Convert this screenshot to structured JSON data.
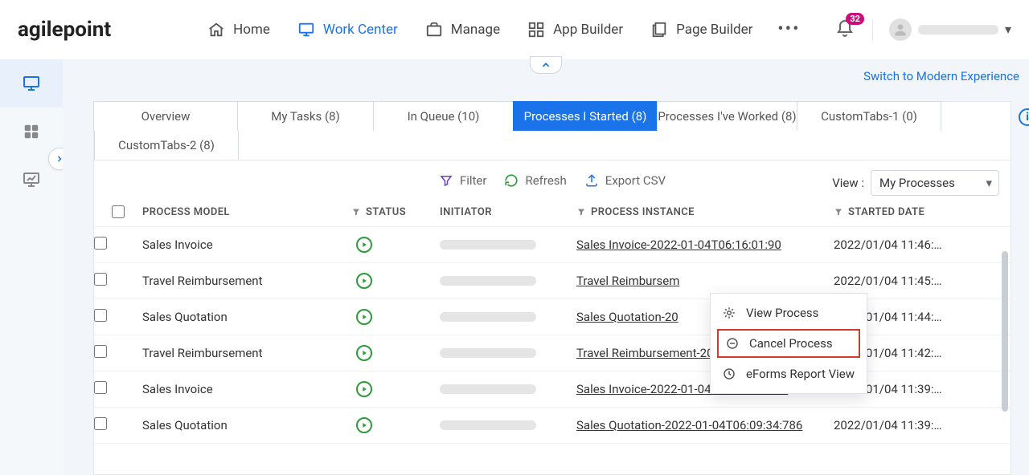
{
  "brand": "agilepoint",
  "nav": {
    "home": "Home",
    "workcenter": "Work Center",
    "manage": "Manage",
    "appbuilder": "App Builder",
    "pagebuilder": "Page Builder"
  },
  "notifications": {
    "count": "32"
  },
  "switch_link": "Switch to Modern Experience",
  "tabs": {
    "overview": "Overview",
    "mytasks": "My Tasks (8)",
    "inqueue": "In Queue (10)",
    "started": "Processes I Started (8)",
    "worked": "Processes I've Worked (8)",
    "custom1": "CustomTabs-1  (0)",
    "custom2": "CustomTabs-2  (8)",
    "widths": {
      "overview": 180,
      "mytasks": 170,
      "inqueue": 175,
      "started": 180,
      "worked": 175,
      "custom1": 180,
      "custom2": 180
    }
  },
  "toolbar": {
    "filter": "Filter",
    "refresh": "Refresh",
    "export": "Export CSV",
    "view_label": "View :",
    "view_selected": "My Processes"
  },
  "columns": {
    "model": "PROCESS MODEL",
    "status": "STATUS",
    "initiator": "INITIATOR",
    "instance": "PROCESS INSTANCE",
    "started": "STARTED DATE"
  },
  "rows": [
    {
      "model": "Sales Invoice",
      "instance": "Sales Invoice-2022-01-04T06:16:01:90",
      "date": "2022/01/04 11:46:…"
    },
    {
      "model": "Travel Reimbursement",
      "instance": "Travel Reimbursem",
      "date": "2022/01/04 11:45:…"
    },
    {
      "model": "Sales Quotation",
      "instance": "Sales Quotation-20",
      "date": "2022/01/04 11:44:…"
    },
    {
      "model": "Travel Reimbursement",
      "instance": "Travel Reimbursement-2022-01-04T06:12:31…",
      "date": "2022/01/04 11:42:…"
    },
    {
      "model": "Sales Invoice",
      "instance": "Sales Invoice-2022-01-04T06:09:46:223",
      "date": "2022/01/04 11:39:…"
    },
    {
      "model": "Sales Quotation",
      "instance": "Sales Quotation-2022-01-04T06:09:34:786",
      "date": "2022/01/04 11:39:…"
    }
  ],
  "contextmenu": {
    "view": "View Process",
    "cancel": "Cancel Process",
    "eforms": "eForms Report View"
  }
}
